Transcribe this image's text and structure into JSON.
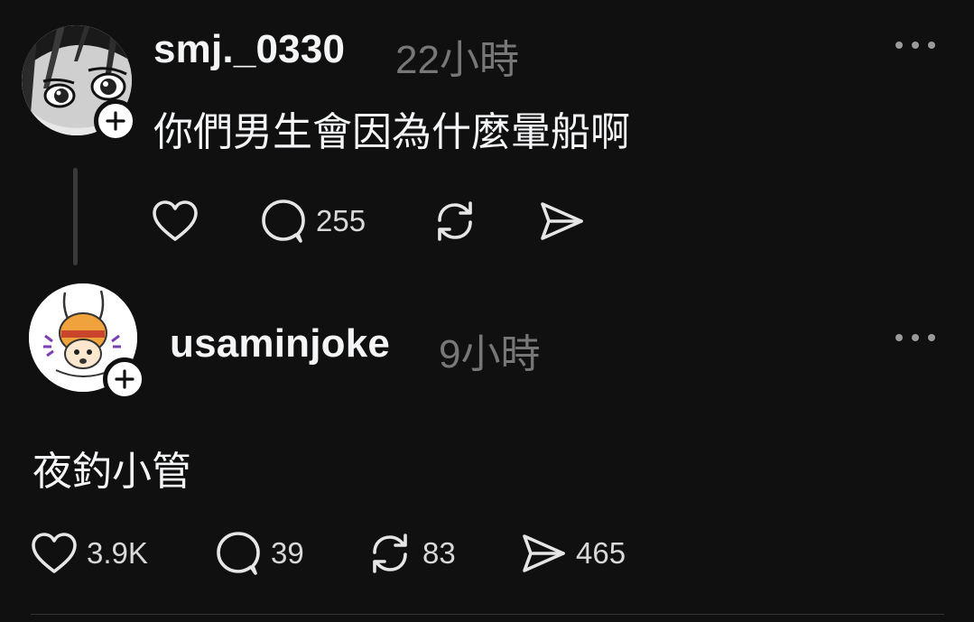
{
  "posts": [
    {
      "username": "smj._0330",
      "time": "22小時",
      "text": "你們男生會因為什麼暈船啊",
      "actions": {
        "like_count": "",
        "reply_count": "255",
        "repost_count": "",
        "share_count": ""
      },
      "icons": [
        "heart-icon",
        "comment-bubble-icon",
        "repost-icon",
        "send-icon",
        "more-dots-icon",
        "follow-plus-icon"
      ]
    },
    {
      "username": "usaminjoke",
      "time": "9小時",
      "text": "夜釣小管",
      "actions": {
        "like_count": "3.9K",
        "reply_count": "39",
        "repost_count": "83",
        "share_count": "465"
      },
      "icons": [
        "heart-icon",
        "comment-bubble-icon",
        "repost-icon",
        "send-icon",
        "more-dots-icon",
        "follow-plus-icon"
      ]
    }
  ],
  "colors": {
    "background": "#101010",
    "text_primary": "#f3f5f7",
    "text_secondary": "#777777",
    "thread_line": "#3a3a3a"
  }
}
